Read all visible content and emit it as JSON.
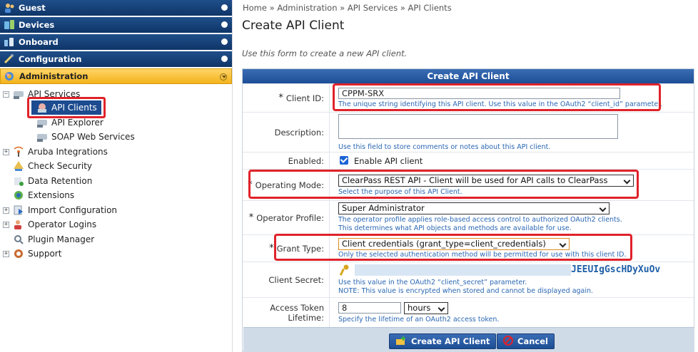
{
  "sidebar": {
    "nav": [
      {
        "label": "Guest",
        "icon": "guest-icon"
      },
      {
        "label": "Devices",
        "icon": "devices-icon"
      },
      {
        "label": "Onboard",
        "icon": "onboard-icon"
      },
      {
        "label": "Configuration",
        "icon": "configuration-icon"
      },
      {
        "label": "Administration",
        "icon": "administration-icon"
      }
    ],
    "tree": [
      {
        "label": "API Services",
        "toggle": "−"
      },
      {
        "label": "API Clients"
      },
      {
        "label": "API Explorer"
      },
      {
        "label": "SOAP Web Services"
      },
      {
        "label": "Aruba Integrations",
        "toggle": "+"
      },
      {
        "label": "Check Security"
      },
      {
        "label": "Data Retention"
      },
      {
        "label": "Extensions"
      },
      {
        "label": "Import Configuration",
        "toggle": "+"
      },
      {
        "label": "Operator Logins",
        "toggle": "+"
      },
      {
        "label": "Plugin Manager"
      },
      {
        "label": "Support",
        "toggle": "+"
      }
    ]
  },
  "breadcrumb": {
    "home": "Home",
    "sep": " » ",
    "admin": "Administration",
    "api_services": "API Services",
    "api_clients": "API Clients"
  },
  "page": {
    "title": "Create API Client",
    "intro": "Use this form to create a new API client."
  },
  "form": {
    "header": "Create API Client",
    "required_mark": "*",
    "client_id": {
      "label": "Client ID:",
      "value": "CPPM-SRX",
      "hint": "The unique string identifying this API client. Use this value in the OAuth2 “client_id” parameter."
    },
    "description": {
      "label": "Description:",
      "value": "",
      "hint": "Use this field to store comments or notes about this API client."
    },
    "enabled": {
      "label": "Enabled:",
      "checkbox_label": "Enable API client",
      "checked": true
    },
    "operating_mode": {
      "label": "Operating Mode:",
      "value": "ClearPass REST API - Client will be used for API calls to ClearPass",
      "hint": "Select the purpose of this API Client."
    },
    "operator_profile": {
      "label": "Operator Profile:",
      "value": "Super Administrator",
      "hint1": "The operator profile applies role-based access control to authorized OAuth2 clients.",
      "hint2": "This determines what API objects and methods are available for use."
    },
    "grant_type": {
      "label": "Grant Type:",
      "value": "Client credentials (grant_type=client_credentials)",
      "hint": "Only the selected authentication method will be permitted for use with this client ID."
    },
    "client_secret": {
      "label": "Client Secret:",
      "value": "JEEUIgGscHDyXuOv",
      "hint1": "Use this value in the OAuth2 “client_secret” parameter.",
      "hint2": "NOTE: This value is encrypted when stored and cannot be displayed again."
    },
    "token_lifetime": {
      "label": "Access Token Lifetime:",
      "value": "8",
      "unit": "hours",
      "hint": "Specify the lifetime of an OAuth2 access token."
    },
    "buttons": {
      "create": "Create API Client",
      "cancel": "Cancel"
    }
  },
  "colors": {
    "nav_blue": "#0f3568",
    "active_gold": "#f3b31c",
    "highlight_red": "#e0222a",
    "hint_blue": "#2a67b3"
  }
}
